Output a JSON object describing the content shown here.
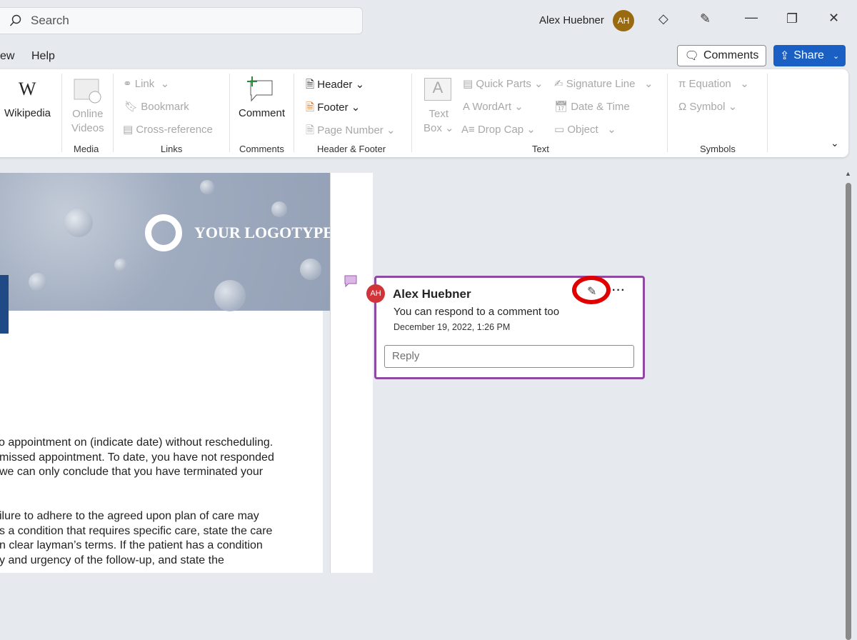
{
  "titlebar": {
    "search_placeholder": "Search",
    "user_name": "Alex Huebner",
    "user_initials": "AH"
  },
  "menu": {
    "items": [
      "ew",
      "Help"
    ]
  },
  "actions": {
    "comments": "Comments",
    "share": "Share"
  },
  "ribbon": {
    "wikipedia": "Wikipedia",
    "online_videos": [
      "Online",
      "Videos"
    ],
    "media_group": "Media",
    "link": "Link",
    "bookmark": "Bookmark",
    "cross_reference": "Cross-reference",
    "links_group": "Links",
    "comment": "Comment",
    "comments_group": "Comments",
    "header": "Header",
    "footer": "Footer",
    "page_number": "Page Number",
    "hf_group": "Header & Footer",
    "text_box": [
      "Text",
      "Box"
    ],
    "quick_parts": "Quick Parts",
    "wordart": "WordArt",
    "drop_cap": "Drop Cap",
    "signature_line": "Signature Line",
    "date_time": "Date & Time",
    "object": "Object",
    "text_group": "Text",
    "equation": "Equation",
    "symbol": "Symbol",
    "symbols_group": "Symbols"
  },
  "document": {
    "logotype": "YOUR LOGOTYPE",
    "para1": [
      "o appointment on (indicate date) without rescheduling.",
      "missed appointment. To date, you have not responded",
      "we can only conclude that you have terminated your"
    ],
    "para2": [
      "ilure to adhere to the agreed upon plan of care may",
      "s a condition that requires specific care, state the care",
      "n clear layman’s terms. If the patient has a condition",
      "y and urgency of the follow-up, and state the"
    ]
  },
  "comment": {
    "author": "Alex Huebner",
    "initials": "AH",
    "text": "You can respond to a comment too",
    "timestamp": "December 19, 2022, 1:26 PM",
    "reply_placeholder": "Reply"
  },
  "colors": {
    "accent": "#1a5fc4",
    "comment_border": "#8e4aa0",
    "highlight": "#e00000",
    "avatar_comment": "#d13438"
  }
}
